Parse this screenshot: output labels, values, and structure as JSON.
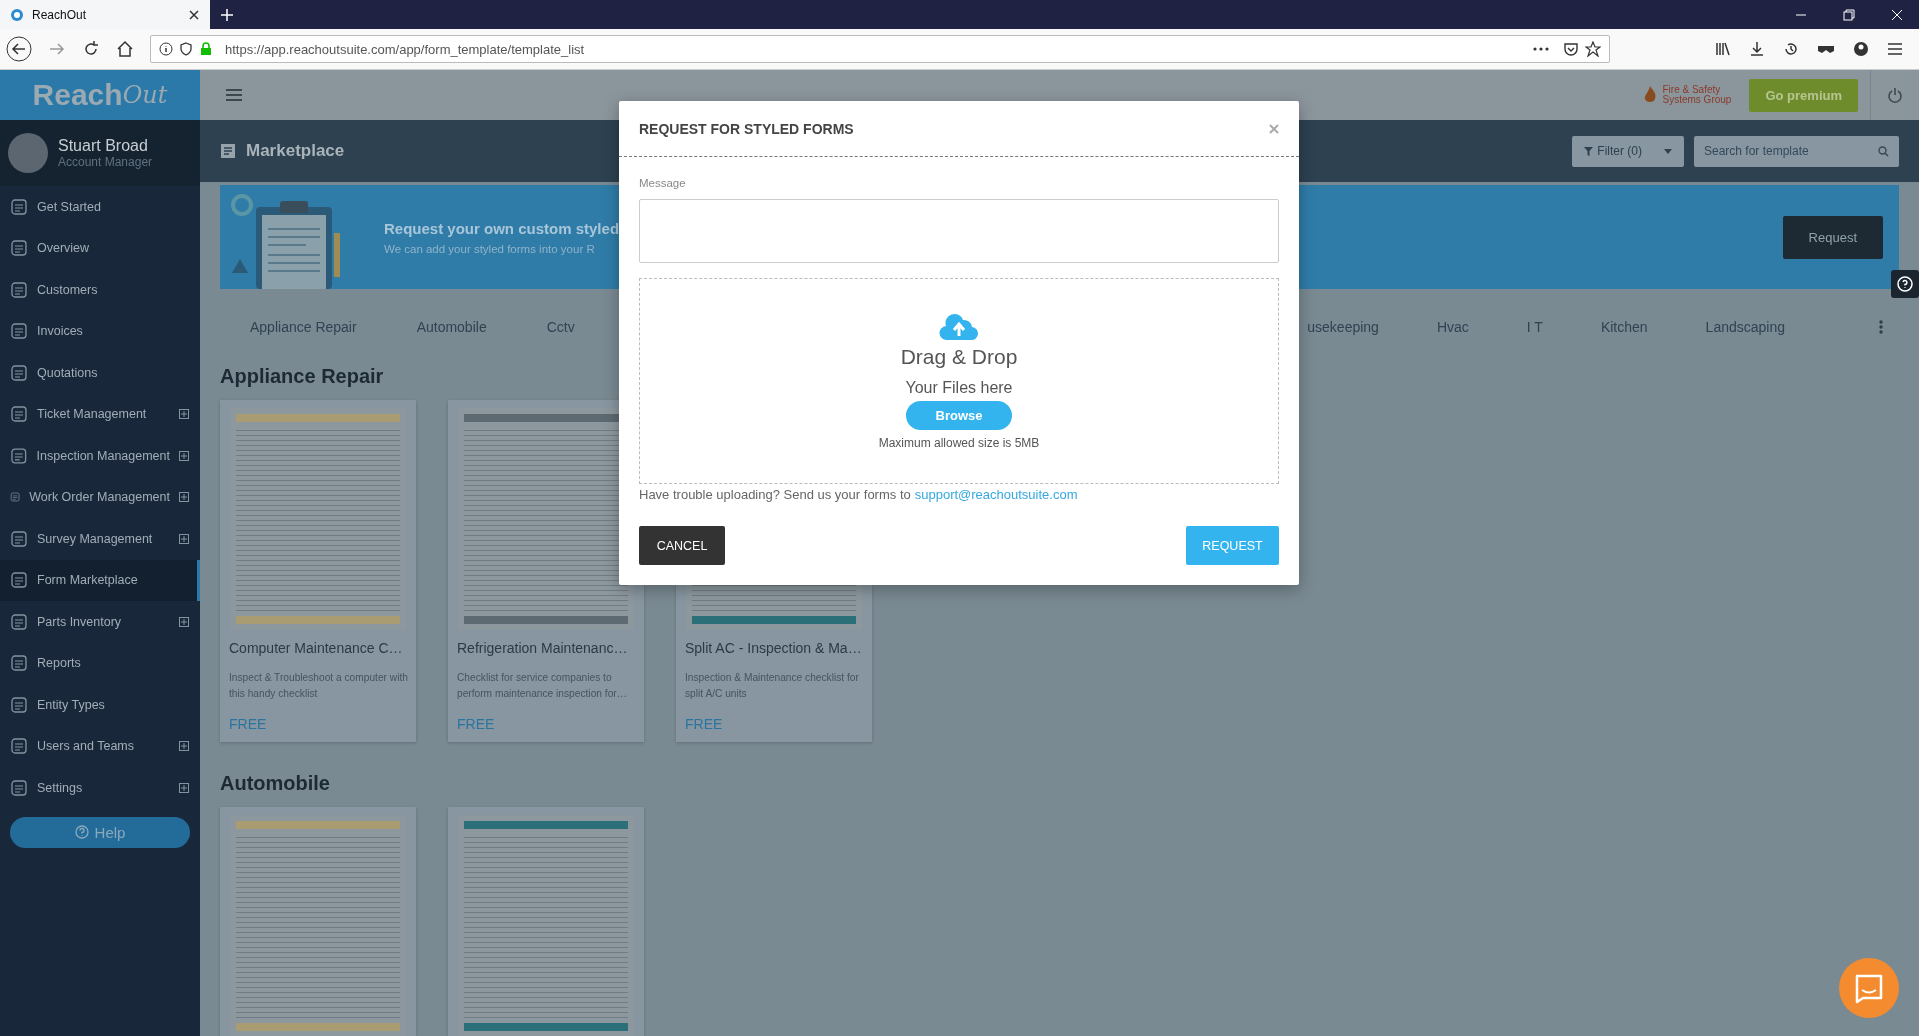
{
  "browser": {
    "tab_title": "ReachOut",
    "url": "https://app.reachoutsuite.com/app/form_template/template_list"
  },
  "sidebar": {
    "logo": {
      "word": "Reach",
      "script": "Out"
    },
    "user": {
      "name": "Stuart Broad",
      "role": "Account Manager"
    },
    "items": [
      {
        "label": "Get Started",
        "expandable": false,
        "selected": false
      },
      {
        "label": "Overview",
        "expandable": false,
        "selected": false
      },
      {
        "label": "Customers",
        "expandable": false,
        "selected": false
      },
      {
        "label": "Invoices",
        "expandable": false,
        "selected": false
      },
      {
        "label": "Quotations",
        "expandable": false,
        "selected": false
      },
      {
        "label": "Ticket Management",
        "expandable": true,
        "selected": false
      },
      {
        "label": "Inspection Management",
        "expandable": true,
        "selected": false
      },
      {
        "label": "Work Order Management",
        "expandable": true,
        "selected": false
      },
      {
        "label": "Survey Management",
        "expandable": true,
        "selected": false
      },
      {
        "label": "Form Marketplace",
        "expandable": false,
        "selected": true
      },
      {
        "label": "Parts Inventory",
        "expandable": true,
        "selected": false
      },
      {
        "label": "Reports",
        "expandable": false,
        "selected": false
      },
      {
        "label": "Entity Types",
        "expandable": false,
        "selected": false
      },
      {
        "label": "Users and Teams",
        "expandable": true,
        "selected": false
      },
      {
        "label": "Settings",
        "expandable": true,
        "selected": false
      }
    ],
    "help_button": "Help"
  },
  "header": {
    "brand": {
      "line1": "Fire & Safety",
      "line2": "Systems Group"
    },
    "premium_button": "Go premium"
  },
  "page": {
    "title": "Marketplace",
    "filter_button": "Filter (0)",
    "search": {
      "placeholder": "Search for template"
    }
  },
  "banner": {
    "heading": "Request your own custom styled",
    "text": "We can add your styled forms into your R",
    "button": "Request"
  },
  "categories": [
    "Appliance Repair",
    "Automobile",
    "Cctv",
    "usekeeping",
    "Hvac",
    "I T",
    "Kitchen",
    "Landscaping"
  ],
  "sections": [
    {
      "title": "Appliance Repair",
      "cards": [
        {
          "kind": "full",
          "title": "Computer Maintenance C…",
          "description": "Inspect & Troubleshoot a computer with this handy checklist",
          "price": "FREE"
        },
        {
          "kind": "full",
          "title": "Refrigeration Maintenanc…",
          "description": "Checklist for service companies to perform maintenance inspection for…",
          "price": "FREE"
        },
        {
          "kind": "full",
          "title": "Split AC - Inspection & Ma…",
          "description": "Inspection & Maintenance checklist for split A/C units",
          "price": "FREE"
        }
      ]
    },
    {
      "title": "Automobile",
      "cards": [
        {
          "kind": "preview"
        },
        {
          "kind": "preview"
        }
      ]
    }
  ],
  "modal": {
    "title": "REQUEST FOR STYLED FORMS",
    "message_label": "Message",
    "dropzone": {
      "heading": "Drag & Drop",
      "subheading": "Your Files here",
      "browse_button": "Browse",
      "limit": "Maximum allowed size is 5MB"
    },
    "help_text": "Have trouble uploading? Send us your forms to",
    "email": "support@reachoutsuite.com",
    "cancel_button": "CANCEL",
    "submit_button": "REQUEST"
  }
}
